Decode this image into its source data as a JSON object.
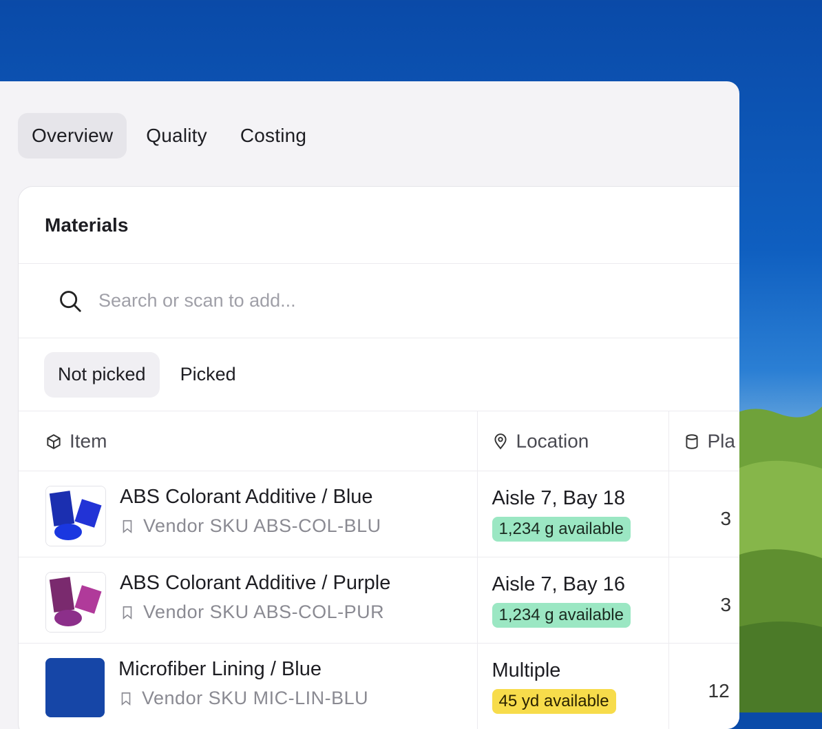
{
  "tabs": [
    {
      "label": "Overview",
      "active": true
    },
    {
      "label": "Quality",
      "active": false
    },
    {
      "label": "Costing",
      "active": false
    }
  ],
  "card": {
    "title": "Materials",
    "search_placeholder": "Search or scan to add...",
    "filters": [
      {
        "label": "Not picked",
        "active": true
      },
      {
        "label": "Picked",
        "active": false
      }
    ]
  },
  "table": {
    "columns": {
      "item": "Item",
      "location": "Location",
      "planned": "Pla"
    },
    "rows": [
      {
        "name": "ABS Colorant Additive / Blue",
        "sku": "Vendor SKU  ABS-COL-BLU",
        "location": "Aisle 7, Bay 18",
        "available": "1,234 g available",
        "badge_color": "#9be7c3",
        "qty": "3",
        "thumb": "blue-pellets"
      },
      {
        "name": "ABS Colorant Additive / Purple",
        "sku": "Vendor SKU  ABS-COL-PUR",
        "location": "Aisle 7, Bay 16",
        "available": "1,234 g available",
        "badge_color": "#9be7c3",
        "qty": "3",
        "thumb": "purple-pellets"
      },
      {
        "name": "Microfiber Lining / Blue",
        "sku": "Vendor SKU  MIC-LIN-BLU",
        "location": "Multiple",
        "available": "45 yd available",
        "badge_color": "#f7dc4b",
        "qty": "12",
        "thumb": "blue-fabric"
      }
    ]
  },
  "colors": {
    "accent_green": "#9be7c3",
    "accent_yellow": "#f7dc4b",
    "text": "#1d1d22"
  }
}
